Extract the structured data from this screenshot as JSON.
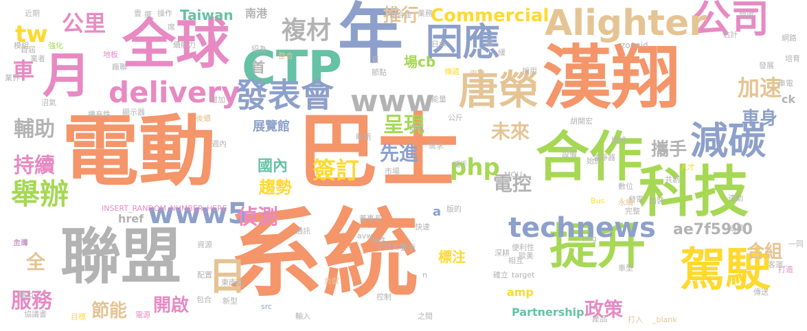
{
  "word_cloud": {
    "words": [
      "電動",
      "巴士",
      "系統",
      "漢翔",
      "年",
      "全球",
      "聯盟",
      "合作",
      "科技",
      "提升",
      "駕駛",
      "減碳",
      "公司",
      "因應",
      "月",
      "CTP",
      "Alighter",
      "唐榮",
      "發表會",
      "www",
      "delivery",
      "www5",
      "technews",
      "舉辦",
      "日",
      "公里",
      "複材",
      "tw",
      "車",
      "輔助",
      "持續",
      "服務",
      "全",
      "php",
      "簽訂",
      "先進",
      "未來",
      "呈現",
      "推行",
      "Commercial",
      "Taiwan",
      "南港",
      "展覽館",
      "國內",
      "電控",
      "加速",
      "車身",
      "攜手",
      "偵測",
      "趨勢",
      "ae7f5990",
      "合組",
      "節能",
      "開啟",
      "政策",
      "Partnership",
      "amp",
      "href",
      "首",
      "場cb",
      "ck",
      "INSERT_RANDOM_NUMBER_HERE",
      "MOU",
      "Bus",
      "img",
      "_blank",
      "src",
      "target",
      "zoneid",
      "avw",
      "中興大學",
      "東南亞",
      "新型",
      "電源",
      "目標",
      "協議書",
      "輸出",
      "主導",
      "台灣",
      "資源",
      "近期",
      "模組",
      "強化",
      "首屆",
      "業者",
      "業界",
      "沼氣",
      "擴充性",
      "顯示器",
      "續航力",
      "地板",
      "廠聯",
      "整合",
      "行車",
      "加裝",
      "發電",
      "完整",
      "數位",
      "永續",
      "胡開宏",
      "人才",
      "共創",
      "成果",
      "環境",
      "設備",
      "濾淨器",
      "始於",
      "攜手",
      "需求",
      "便利性",
      "董事長",
      "弾性",
      "技術",
      "歐美",
      "深耕",
      "確立",
      "相互",
      "車型",
      "貢獻",
      "控制",
      "輸入",
      "之間",
      "產品",
      "打入",
      "傳送",
      "打造",
      "鋁合金",
      "營收",
      "培育",
      "網路",
      "發展",
      "車電",
      "估計",
      "一同",
      "速動",
      "採用",
      "日本",
      "增加",
      "業務",
      "市場",
      "時期",
      "通訊",
      "週內",
      "後續",
      "電巴",
      "能量",
      "傳遞",
      "節點",
      "版的",
      "快速",
      "壹",
      "擺",
      "操作",
      "席",
      "招為",
      "瀏",
      "緩",
      "頁",
      "既有",
      "公斤",
      "客運",
      "配置",
      "包合",
      "標注",
      "a",
      "n"
    ]
  }
}
